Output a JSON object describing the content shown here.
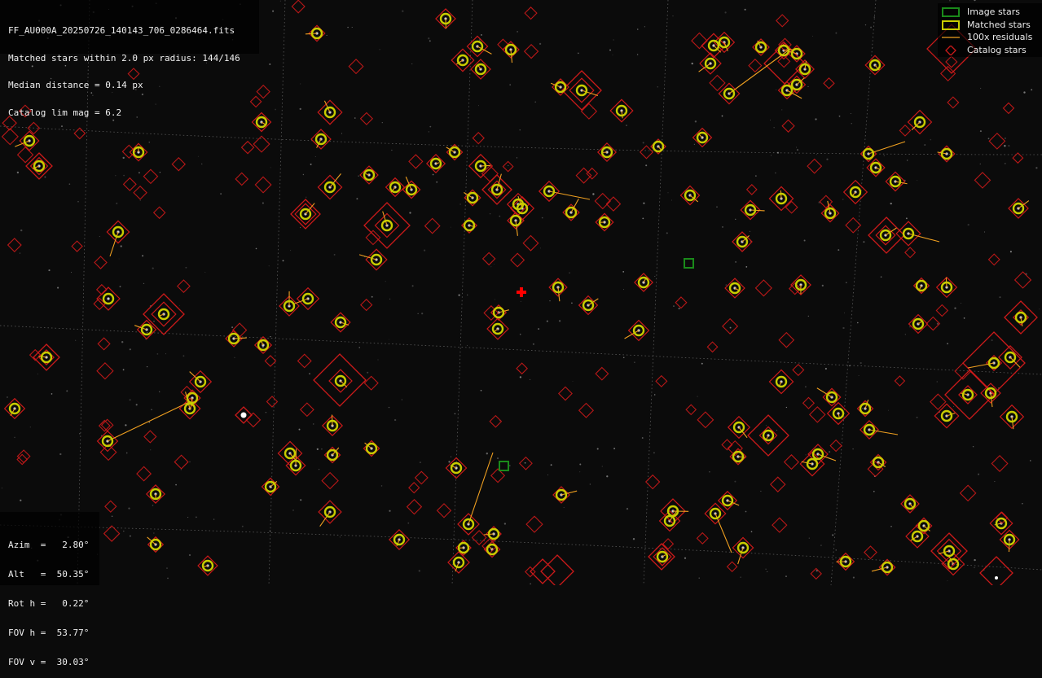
{
  "file_name": "FF_AU000A_20250726_140143_706_0286464.fits",
  "stats": {
    "matched_line": "Matched stars within 2.0 px radius: 144/146",
    "median_line": "Median distance = 0.14 px",
    "catalog_line": "Catalog lim mag = 6.2"
  },
  "legend": {
    "image_stars": "Image stars",
    "matched_stars": "Matched stars",
    "residuals": "100x residuals",
    "catalog_stars": "Catalog stars"
  },
  "pointing": {
    "azim": "Azim  =   2.80°",
    "alt": "Alt   =  50.35°",
    "roth": "Rot h =   0.22°",
    "fovh": "FOV h =  53.77°",
    "fovv": "FOV v =  30.03°"
  },
  "colors": {
    "background": "#0b0b0b",
    "image_star_marker": "#1a8a1a",
    "matched_star_marker": "#c8cc00",
    "residual_line": "#f0a020",
    "catalog_star_marker": "#cc1a1a",
    "center_marker": "#ff0000",
    "grid": "#7a7a7a"
  }
}
